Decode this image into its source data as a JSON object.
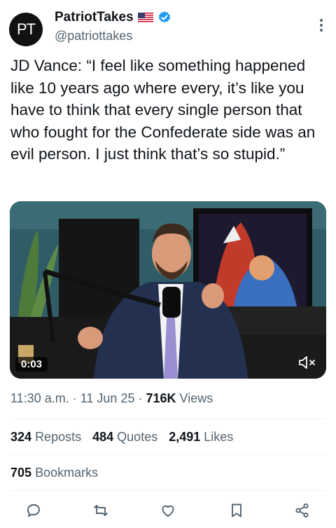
{
  "author": {
    "avatar_text": "PT",
    "name": "PatriotTakes",
    "handle": "@patriottakes",
    "flag_icon": "us-flag-icon",
    "verified_icon": "verified-badge-icon",
    "verified_color": "#1d9bf0"
  },
  "tweet": {
    "text": "JD Vance: “I feel like something happened like 10 years ago where every, it’s like you have to think that every single person that who fought for the Confederate side was an evil person. I just think that’s so stupid.”"
  },
  "media": {
    "duration": "0:03",
    "mute_icon": "volume-muted-icon"
  },
  "meta": {
    "time": "11:30 a.m.",
    "date": "11 Jun 25",
    "views_count": "716K",
    "views_label": "Views"
  },
  "stats": {
    "reposts_count": "324",
    "reposts_label": "Reposts",
    "quotes_count": "484",
    "quotes_label": "Quotes",
    "likes_count": "2,491",
    "likes_label": "Likes",
    "bookmarks_count": "705",
    "bookmarks_label": "Bookmarks"
  },
  "actions": [
    "reply-icon",
    "repost-icon",
    "like-icon",
    "bookmark-icon",
    "share-icon"
  ]
}
